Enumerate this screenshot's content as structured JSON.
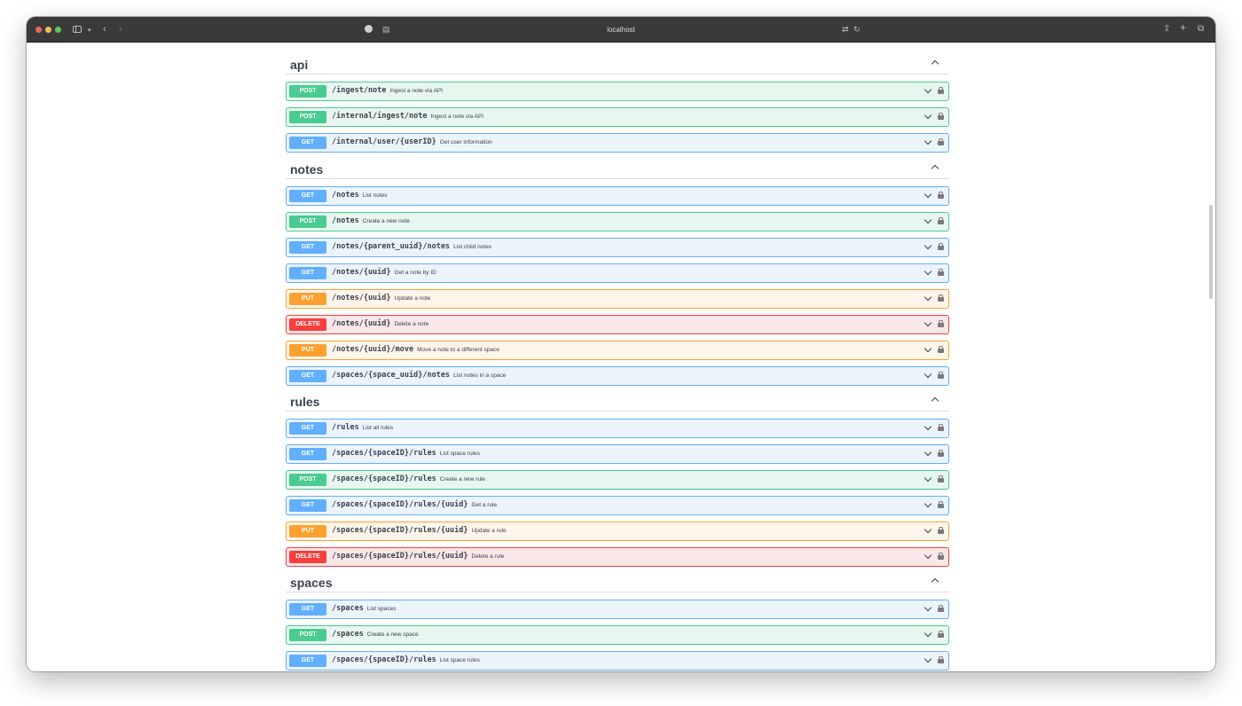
{
  "browser": {
    "url": "localhost"
  },
  "sections": [
    {
      "title": "api",
      "operations": [
        {
          "method": "POST",
          "path": "/ingest/note",
          "summary": "Ingest a note via API"
        },
        {
          "method": "POST",
          "path": "/internal/ingest/note",
          "summary": "Ingest a note via API"
        },
        {
          "method": "GET",
          "path": "/internal/user/{userID}",
          "summary": "Get user information"
        }
      ]
    },
    {
      "title": "notes",
      "operations": [
        {
          "method": "GET",
          "path": "/notes",
          "summary": "List notes"
        },
        {
          "method": "POST",
          "path": "/notes",
          "summary": "Create a new note"
        },
        {
          "method": "GET",
          "path": "/notes/{parent_uuid}/notes",
          "summary": "List child notes"
        },
        {
          "method": "GET",
          "path": "/notes/{uuid}",
          "summary": "Get a note by ID"
        },
        {
          "method": "PUT",
          "path": "/notes/{uuid}",
          "summary": "Update a note"
        },
        {
          "method": "DELETE",
          "path": "/notes/{uuid}",
          "summary": "Delete a note"
        },
        {
          "method": "PUT",
          "path": "/notes/{uuid}/move",
          "summary": "Move a note to a different space"
        },
        {
          "method": "GET",
          "path": "/spaces/{space_uuid}/notes",
          "summary": "List notes in a space"
        }
      ]
    },
    {
      "title": "rules",
      "operations": [
        {
          "method": "GET",
          "path": "/rules",
          "summary": "List all rules"
        },
        {
          "method": "GET",
          "path": "/spaces/{spaceID}/rules",
          "summary": "List space rules"
        },
        {
          "method": "POST",
          "path": "/spaces/{spaceID}/rules",
          "summary": "Create a new rule"
        },
        {
          "method": "GET",
          "path": "/spaces/{spaceID}/rules/{uuid}",
          "summary": "Get a rule"
        },
        {
          "method": "PUT",
          "path": "/spaces/{spaceID}/rules/{uuid}",
          "summary": "Update a rule"
        },
        {
          "method": "DELETE",
          "path": "/spaces/{spaceID}/rules/{uuid}",
          "summary": "Delete a rule"
        }
      ]
    },
    {
      "title": "spaces",
      "operations": [
        {
          "method": "GET",
          "path": "/spaces",
          "summary": "List spaces"
        },
        {
          "method": "POST",
          "path": "/spaces",
          "summary": "Create a new space"
        },
        {
          "method": "GET",
          "path": "/spaces/{spaceID}/rules",
          "summary": "List space rules"
        }
      ]
    }
  ],
  "colors": {
    "get": "#61affe",
    "post": "#49cc90",
    "put": "#fca130",
    "delete": "#f93e3e"
  },
  "icons": {
    "section_toggle": "chevron-up-icon",
    "op_expand": "chevron-down-icon",
    "op_auth": "lock-icon"
  }
}
